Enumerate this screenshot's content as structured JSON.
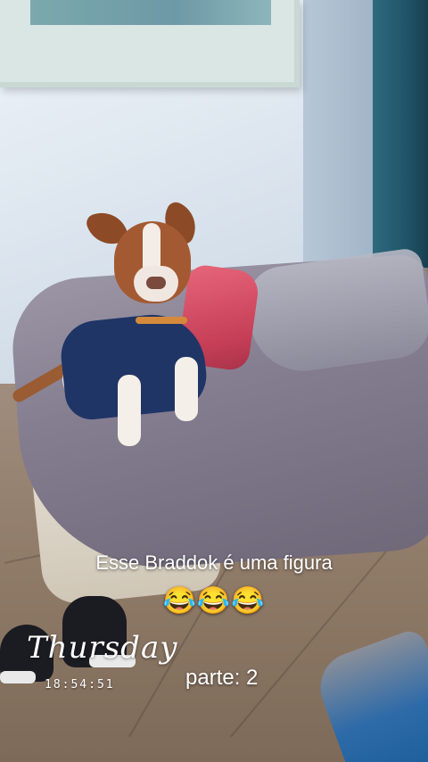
{
  "overlay": {
    "caption_line1": "Esse Braddok é uma figura",
    "caption_line2": "😂😂😂",
    "day": "Thursday",
    "time": "18:54:51",
    "part": "parte: 2"
  }
}
